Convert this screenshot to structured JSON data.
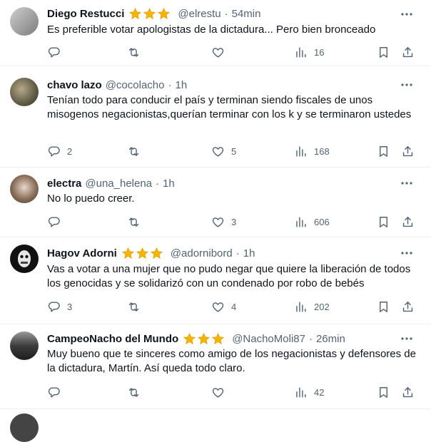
{
  "tweets": [
    {
      "name": "Diego Restucci",
      "stars": 3,
      "handle": "@elrestu",
      "time": "54min",
      "text": "Es preferible votar apologistas de la dictadura... Pero bien bronceado",
      "replies": "",
      "reposts": "",
      "likes": "",
      "views": "16"
    },
    {
      "name": "chavo lazo",
      "stars": 0,
      "handle": "@cocolacho",
      "time": "1h",
      "text": "Tenían todo para conducir el país y terminan siendo fiscales de unos misogenos negacionistas,querían terminar con los k y se terminaron ustedes",
      "replies": "2",
      "reposts": "",
      "likes": "5",
      "views": "168"
    },
    {
      "name": "electra",
      "stars": 0,
      "handle": "@una_helena",
      "time": "1h",
      "text": "No lo puedo creer.",
      "replies": "",
      "reposts": "",
      "likes": "3",
      "views": "606"
    },
    {
      "name": "Hagov Adorni",
      "stars": 3,
      "handle": "@adornibord",
      "time": "1h",
      "text": "Vas a votar a una mujer que no pudo negar que quiere la liberación de todos los genocidas y se solidarizó con un condenado por robo de bebés",
      "replies": "3",
      "reposts": "",
      "likes": "4",
      "views": "202"
    },
    {
      "name": "CampeoNacho del Mundo",
      "stars": 3,
      "handle": "@NachoMoli87",
      "time": "26min",
      "text": "Muy bueno que te sinceres como amigo de los negacionistas y defensores de la dictadura, Martín. Así queda todo claro.",
      "replies": "",
      "reposts": "",
      "likes": "",
      "views": "42"
    }
  ],
  "separator": "·",
  "colors": {
    "star": "#f4b400",
    "secondary_text": "#536471",
    "primary_text": "#0f1419",
    "divider": "#eff3f4"
  },
  "icons": [
    "reply-icon",
    "repost-icon",
    "like-icon",
    "views-icon",
    "bookmark-icon",
    "share-icon",
    "more-icon",
    "star-icon"
  ]
}
